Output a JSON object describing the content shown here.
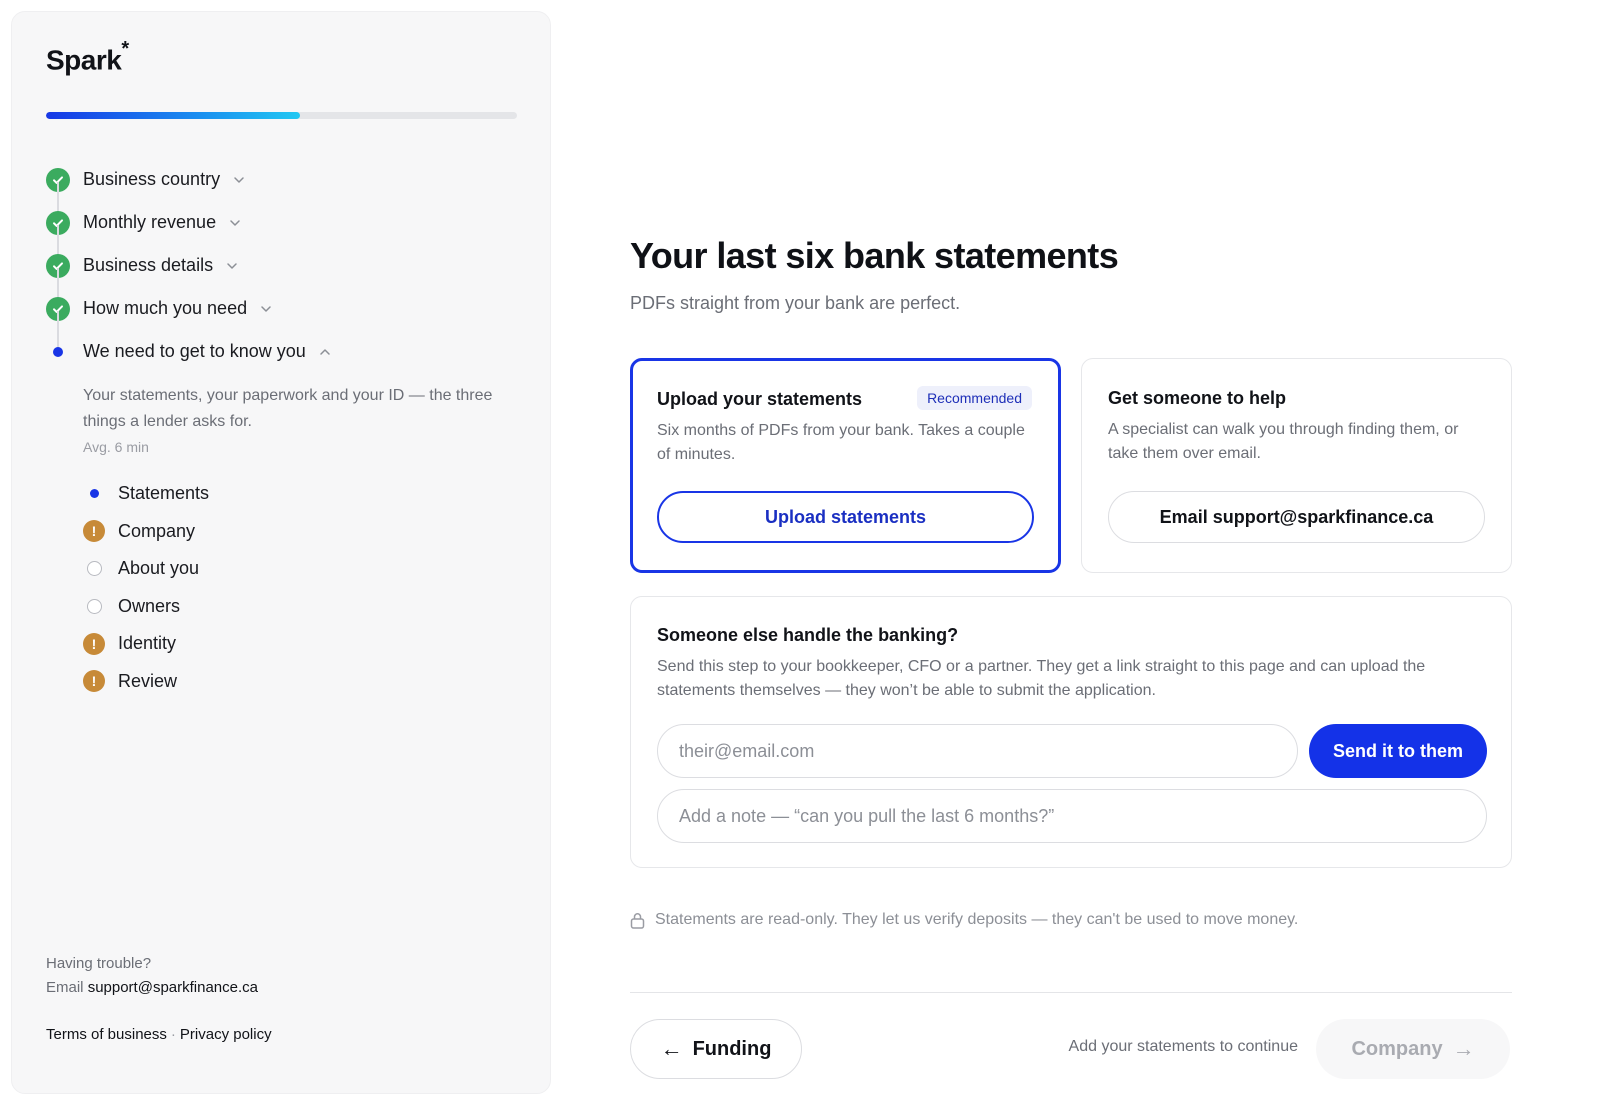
{
  "brand": {
    "name": "Spark",
    "mark": "*"
  },
  "progress": {
    "fraction": 0.54
  },
  "steps": [
    {
      "label": "Business country",
      "status": "complete",
      "icon": "check-icon",
      "expand_icon": "chevron-down-icon"
    },
    {
      "label": "Monthly revenue",
      "status": "complete",
      "icon": "check-icon",
      "expand_icon": "chevron-down-icon"
    },
    {
      "label": "Business details",
      "status": "complete",
      "icon": "check-icon",
      "expand_icon": "chevron-down-icon"
    },
    {
      "label": "How much you need",
      "status": "complete",
      "icon": "check-icon",
      "expand_icon": "chevron-down-icon"
    },
    {
      "label": "We need to get to know you",
      "status": "active",
      "icon": "active-dot-icon",
      "expand_icon": "chevron-up-icon"
    }
  ],
  "active_step": {
    "description": "Your statements, your paperwork and your ID — the three things a lender asks for.",
    "avg": "Avg. 6 min"
  },
  "substeps": [
    {
      "label": "Statements",
      "status": "current",
      "icon": "current-dot-icon"
    },
    {
      "label": "Company",
      "status": "warning",
      "icon": "warning-icon"
    },
    {
      "label": "About you",
      "status": "todo",
      "icon": "empty-circle-icon"
    },
    {
      "label": "Owners",
      "status": "todo",
      "icon": "empty-circle-icon"
    },
    {
      "label": "Identity",
      "status": "warning",
      "icon": "warning-icon"
    },
    {
      "label": "Review",
      "status": "warning",
      "icon": "warning-icon"
    }
  ],
  "warning_glyph": "!",
  "help": {
    "question": "Having trouble?",
    "email_prefix": "Email",
    "email": "support@sparkfinance.ca"
  },
  "legal": {
    "terms": "Terms of business",
    "separator": "·",
    "privacy": "Privacy policy"
  },
  "main": {
    "title": "Your last six bank statements",
    "subtitle": "PDFs straight from your bank are perfect."
  },
  "upload_card": {
    "heading": "Upload your statements",
    "badge": "Recommended",
    "body": "Six months of PDFs from your bank. Takes a couple of minutes.",
    "button": "Upload statements"
  },
  "help_card": {
    "heading": "Get someone to help",
    "body": "A specialist can walk you through finding them, or take them over email.",
    "button": "Email support@sparkfinance.ca"
  },
  "delegate_card": {
    "heading": "Someone else handle the banking?",
    "body": "Send this step to your bookkeeper, CFO or a partner. They get a link straight to this page and can upload the statements themselves — they won’t be able to submit the application.",
    "email_placeholder": "their@email.com",
    "note_placeholder": "Add a note — “can you pull the last 6 months?”",
    "send_button": "Send it to them"
  },
  "security_note": "Statements are read-only. They let us verify deposits — they can't be used to move money.",
  "footer_nav": {
    "back_arrow": "←",
    "back_label": "Funding",
    "hint": "Add your statements to continue",
    "next_label": "Company",
    "next_arrow": "→",
    "next_enabled": false
  },
  "colors": {
    "accent": "#1935e6",
    "success": "#3bab5f",
    "warning": "#c78a38",
    "sidebar_bg": "#f7f7f8"
  }
}
